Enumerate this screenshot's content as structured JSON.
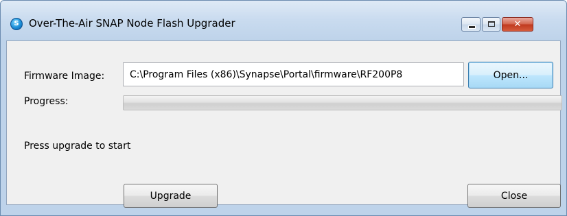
{
  "window": {
    "title": "Over-The-Air SNAP Node Flash Upgrader",
    "app_icon_glyph": "S",
    "icons": {
      "app": "snap-app-icon",
      "minimize": "minimize-icon",
      "maximize": "maximize-icon",
      "close": "close-icon"
    },
    "close_glyph": "✕"
  },
  "form": {
    "firmware_label": "Firmware Image:",
    "firmware_value": "C:\\Program Files (x86)\\Synapse\\Portal\\firmware\\RF200P8",
    "open_button": "Open...",
    "progress_label": "Progress:",
    "progress_percent": 0,
    "status_text": "Press upgrade to start"
  },
  "buttons": {
    "upgrade": "Upgrade",
    "close": "Close"
  },
  "colors": {
    "title_bar": "#c9dbef",
    "client_background": "#f0f0f0",
    "close_button": "#c0391f",
    "focused_button": "#bee6fd"
  }
}
